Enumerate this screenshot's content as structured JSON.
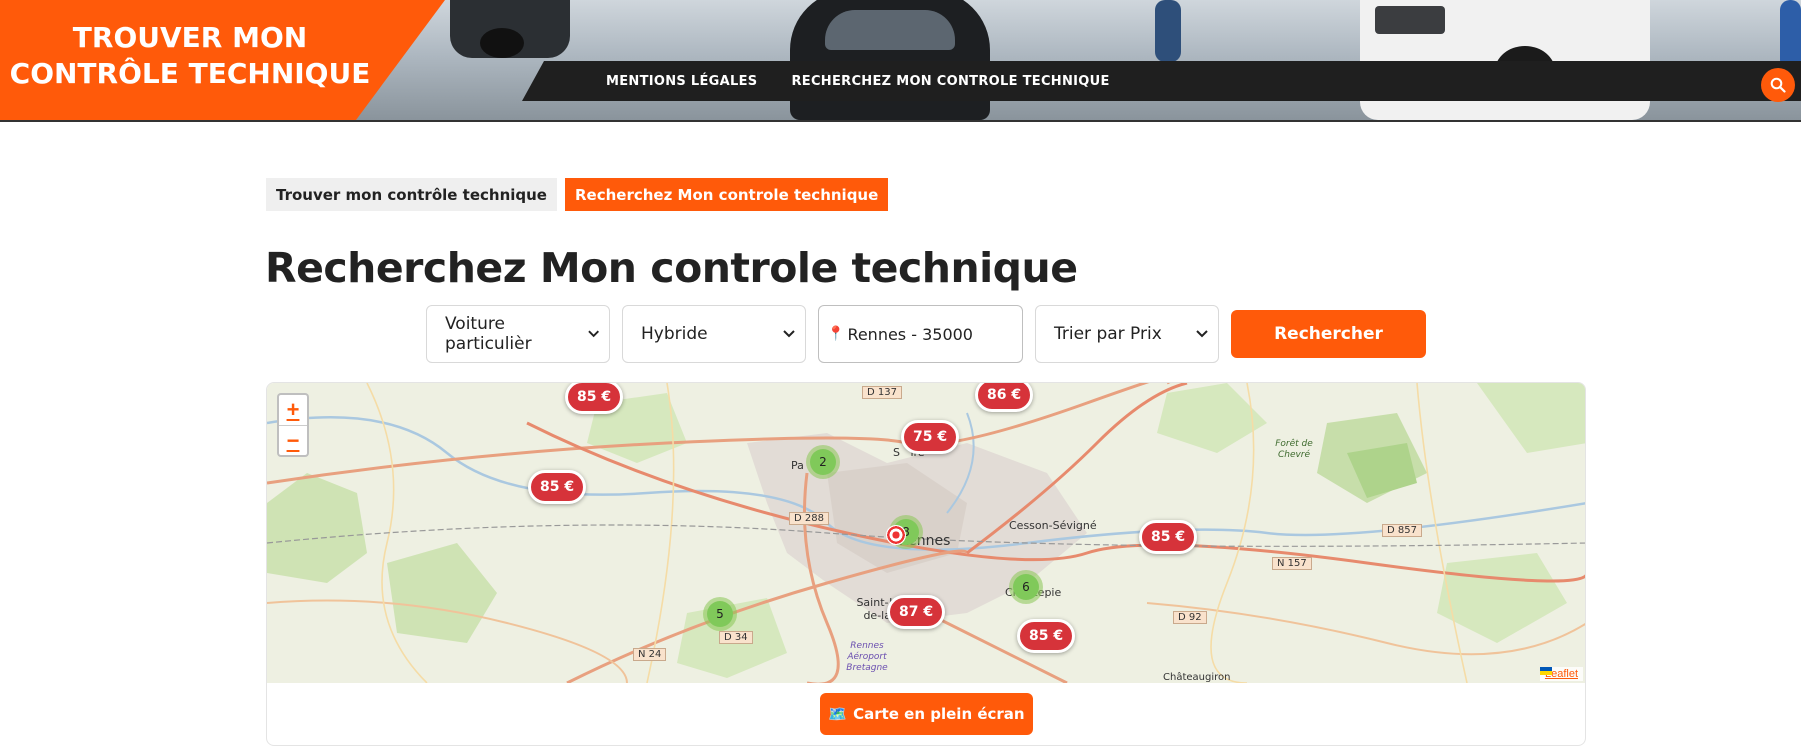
{
  "header": {
    "logo_line1": "TROUVER MON",
    "logo_line2": "CONTRÔLE TECHNIQUE",
    "nav": [
      {
        "label": "MENTIONS LÉGALES"
      },
      {
        "label": "RECHERCHEZ MON CONTROLE TECHNIQUE"
      }
    ],
    "search_icon": "search-icon",
    "accent_color": "#ff5a0a"
  },
  "breadcrumb": {
    "home": "Trouver mon contrôle technique",
    "current": "Recherchez Mon controle technique"
  },
  "page_title": "Recherchez Mon controle technique",
  "filters": {
    "vehicle_type": "Voiture particulièr",
    "fuel_type": "Hybride",
    "location_icon": "📍",
    "location": "Rennes - 35000",
    "sort": "Trier par Prix",
    "submit_label": "Rechercher"
  },
  "map": {
    "zoom_in": "+",
    "zoom_out": "−",
    "price_markers": [
      "85 €",
      "86 €",
      "75 €",
      "85 €",
      "85 €",
      "87 €",
      "85 €"
    ],
    "clusters": [
      "2",
      "8",
      "6",
      "5"
    ],
    "places": {
      "rennes": "Rennes",
      "cesson": "Cesson-Sévigné",
      "chantepie": "Chantepie",
      "st_jacques": "Saint-Jacques-de-la-Lande",
      "aeroport": "Rennes Aéroport Bretagne",
      "foret": "Forêt de Chevré",
      "chateaugiron": "Châteaugiron",
      "pa": "Pa",
      "st_gregoire": "S   ire"
    },
    "roads": [
      "D 137",
      "D 288",
      "N 157",
      "D 857",
      "D 92",
      "D 34",
      "N 24"
    ],
    "attribution": "Leaflet",
    "fullscreen_label": "Carte en plein écran",
    "fullscreen_icon": "🗺️"
  }
}
